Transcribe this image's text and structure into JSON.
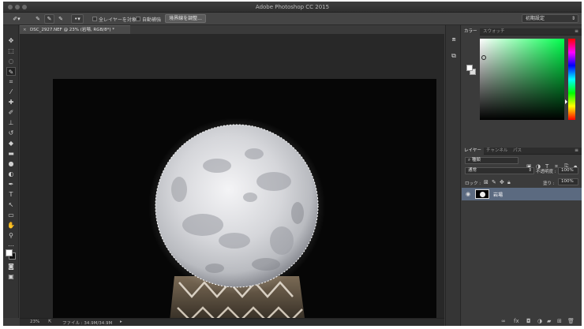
{
  "app": {
    "title": "Adobe Photoshop CC 2015"
  },
  "options_bar": {
    "sample_all_layers": "全レイヤーを対象",
    "auto_enhance": "自動補強",
    "refine_edge": "境界線を調整...",
    "workspace": "初期設定"
  },
  "document": {
    "tab_title": "DSC_2927.NEF @ 23% (岩場, RGB/8*) *",
    "zoom": "23%",
    "file_info": "ファイル : 34.9M/34.9M"
  },
  "panels": {
    "color_tabs": [
      "カラー",
      "スウォッチ"
    ],
    "layer_tabs": [
      "レイヤー",
      "チャンネル",
      "パス"
    ],
    "kind_filter": "種類",
    "blend_mode": "通常",
    "opacity_label": "不透明度 :",
    "opacity_value": "100%",
    "lock_label": "ロック :",
    "fill_label": "塗り :",
    "fill_value": "100%",
    "layers": [
      {
        "name": "岩場"
      }
    ]
  },
  "colors": {
    "selected_layer": "#5b6a80",
    "accent_green": "#00ff4c"
  }
}
